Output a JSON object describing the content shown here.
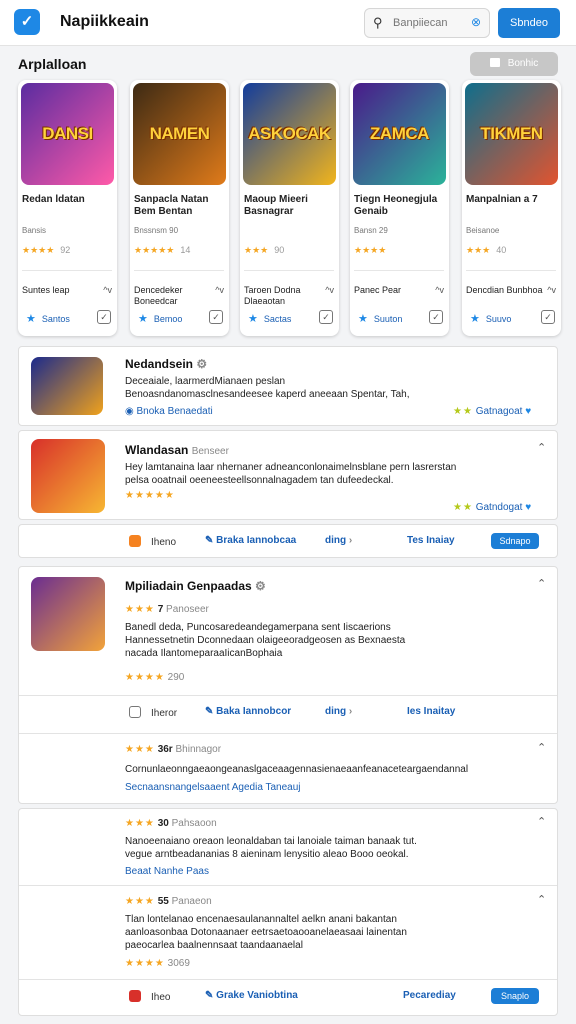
{
  "header": {
    "logo_glyph": "✓",
    "app_title": "Napiikkeain",
    "search_placeholder": "Banpiiecan",
    "search_icon": "search-icon",
    "clear_glyph": "⊗",
    "primary_button": "Sbndeo"
  },
  "section": {
    "title": "Arplalloan",
    "button_label": "Bonhic"
  },
  "cards": [
    {
      "thumb_text": "DANSI",
      "name": "Redan ldatan",
      "meta": "Bansis",
      "stars": "★★★★",
      "score": "92",
      "tag": "Suntes leap",
      "tag_right": "^v",
      "action": "Santos",
      "colors": [
        "#5a2ca0",
        "#ff5aa8"
      ]
    },
    {
      "thumb_text": "NAMEN",
      "name": "Sanpacla Natan Bem Bentan",
      "meta": "Bnssnsm 90",
      "stars": "★★★★★",
      "score": "14",
      "tag": "Dencedeker Boneedcar",
      "tag_right": "^v",
      "action": "Bemoo",
      "colors": [
        "#3d2a14",
        "#e07b1a"
      ]
    },
    {
      "thumb_text": "ASKOCAK",
      "name": "Maoup Mieeri Basnagrar",
      "meta": "",
      "stars": "★★★",
      "score": "90",
      "tag": "Taroen Dodna Dlaeaotan",
      "tag_right": "^v",
      "action": "Sactas",
      "colors": [
        "#123c9c",
        "#f2b51c"
      ]
    },
    {
      "thumb_text": "ZAMCA",
      "name": "Tiegn Heonegjula Genaib",
      "meta": "Bansn 29",
      "stars": "★★★★",
      "score": "",
      "tag": "Panec Pear",
      "tag_right": "^v",
      "action": "Suuton",
      "colors": [
        "#4a1a8a",
        "#2bb39a"
      ]
    },
    {
      "thumb_text": "TIKMEN",
      "name": "Manpalnian a 7",
      "meta": "Beisanoe",
      "stars": "★★★",
      "score": "40",
      "tag": "Dencdian Bunbhoa",
      "tag_right": "^v",
      "action": "Suuvo",
      "colors": [
        "#0f6e8c",
        "#e2542f"
      ]
    }
  ],
  "list1": {
    "title": "Nedandsein",
    "line1": "Deceaiale, laarmerdMianaen peslan",
    "line2": "Benoasndanomasclnesandeesee kaperd aneeaan Spentar, Tah,",
    "link": "Bnoka Benaedati",
    "action": "Gatnagoat"
  },
  "list2": {
    "title": "Wlandasan",
    "badge": "Benseer",
    "line1": "Hey lamtanaina laar nhernaner adneanconlonaimelnsblane pern lasrerstan",
    "line2": "pelsa ooatnail oeeneesteellsonnalnagadem tan dufeedeckal.",
    "stars": "★★★★★",
    "action": "Gatndogat"
  },
  "bar1": {
    "item1": "Iheno",
    "item2": "Braka Iannobcaa",
    "item3": "ding",
    "item4": "Tes Inaiay",
    "pill": "Sdnapo"
  },
  "list3": {
    "title": "Mpiliadain Genpaadas",
    "stars": "★★★",
    "score": "7",
    "badge": "Panoseer",
    "line1": "Banedl deda, Puncosaredeandegamerpana sent Iiscaerions",
    "line2": "Hannessetnetin Dconnedaan olaigeeoradgeosen as Bexnaesta",
    "line3": "nacada IlantomeparaaIicanBophaia",
    "rating": "★★★★",
    "rating_score": "290"
  },
  "bar2": {
    "item1": "Iheror",
    "item2": "Baka Iannobcor",
    "item3": "ding",
    "item4": "Ies Inaitay"
  },
  "sub1": {
    "stars": "★★★",
    "score": "36r",
    "badge": "Bhinnagor",
    "line1": "Cornunlaeonngaeaongeanaslgaceaagennasienaeaanfeanaceteargaendannal",
    "link": "Secnaansnangelsaaent Agedia Taneauj"
  },
  "sub2": {
    "stars": "★★★",
    "score": "30",
    "badge": "Pahsaoon",
    "line1": "Nanoeenaiano oreaon leonaldaban tai lanoiale taiman banaak tut.",
    "line2": "vegue arntbeadananias 8 aieninam lenysitio aleao Booo oeokal.",
    "link": "Beaat Nanhe Paas"
  },
  "sub3": {
    "stars": "★★★",
    "score": "55",
    "badge": "Panaeon",
    "line1": "Tlan lontelanao encenaesaulanannaltel aelkn anani bakantan",
    "line2": "aanloasonbaa Dotonaanaer eetrsaetoaooanelaeasaai lainentan",
    "line3": "paeocarlea baalnennsaat taandaanaelal",
    "rating": "★★★★",
    "rating_score": "3069"
  },
  "bar3": {
    "item1": "Iheo",
    "item2": "Grake Vaniobtina",
    "item3": "Pecarediay",
    "pill": "Snaplo"
  }
}
